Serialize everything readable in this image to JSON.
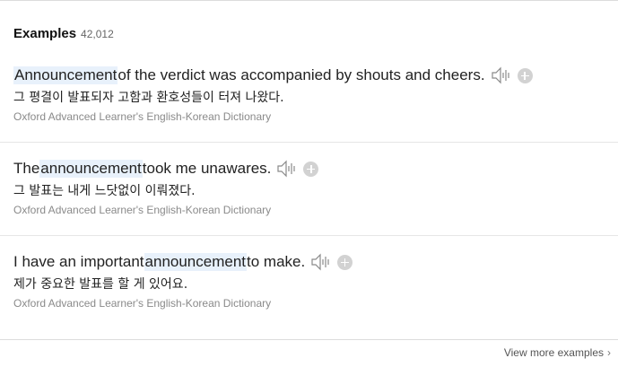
{
  "header": {
    "title": "Examples",
    "count": "42,012"
  },
  "examples": [
    {
      "before": "",
      "term": "Announcement",
      "after": " of the verdict was accompanied by shouts and cheers.",
      "translation": "그 평결이 발표되자 고함과 환호성들이 터져 나왔다.",
      "source": "Oxford Advanced Learner's English-Korean Dictionary"
    },
    {
      "before": "The ",
      "term": "announcement",
      "after": " took me unawares.",
      "translation": "그 발표는 내게 느닷없이 이뤄졌다.",
      "source": "Oxford Advanced Learner's English-Korean Dictionary"
    },
    {
      "before": "I have an important ",
      "term": "announcement",
      "after": " to make.",
      "translation": "제가 중요한 발표를 할 게 있어요.",
      "source": "Oxford Advanced Learner's English-Korean Dictionary"
    }
  ],
  "icons": {
    "audio": "speaker-icon",
    "add": "plus-circle-icon"
  },
  "footer": {
    "more_label": "View more examples",
    "chevron": "›"
  }
}
